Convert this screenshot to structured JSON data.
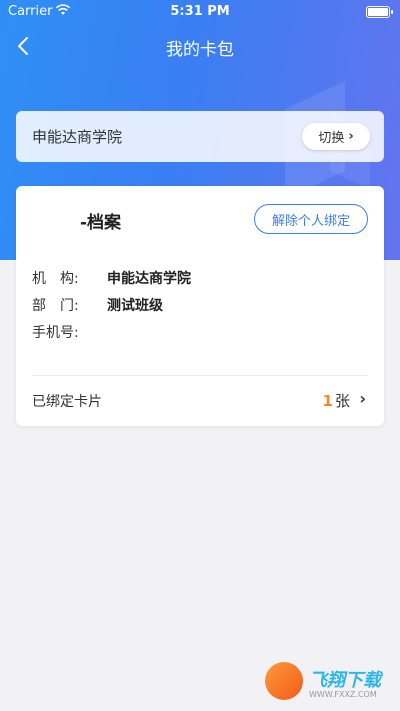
{
  "status_bar": {
    "carrier": "Carrier",
    "time": "5:31 PM"
  },
  "nav": {
    "title": "我的卡包",
    "back_icon": "chevron-left-icon"
  },
  "institution": {
    "name": "申能达商学院",
    "switch_label": "切换"
  },
  "card": {
    "title": "-档案",
    "unbind_label": "解除个人绑定",
    "fields": [
      {
        "label": "机　构:",
        "value": "申能达商学院"
      },
      {
        "label": "部　门:",
        "value": "测试班级"
      },
      {
        "label": "手机号:",
        "value": ""
      }
    ],
    "bound_cards_label": "已绑定卡片",
    "bound_count": "1",
    "bound_unit": "张"
  },
  "watermark": {
    "text": "飞翔下载",
    "sub": "WWW.FXXZ.COM"
  },
  "colors": {
    "primary": "#3a7ef3",
    "accent_count": "#f08a24",
    "background": "#f2f2f4"
  }
}
